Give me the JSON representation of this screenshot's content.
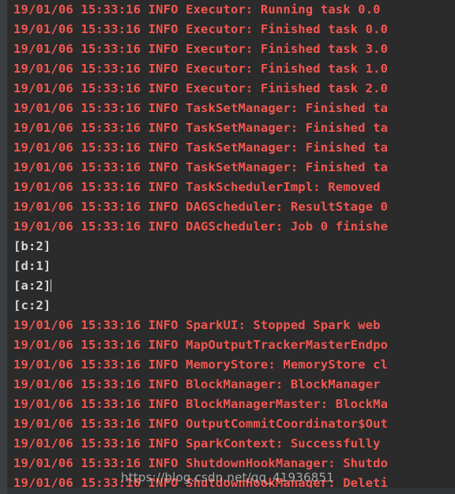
{
  "window": {
    "type": "ide-console-output",
    "background_color": "#2b2b2b",
    "gutter_color": "#3c3f41",
    "stderr_color": "#f4564f",
    "stdout_color": "#d4d8d8"
  },
  "console": {
    "lines": [
      {
        "stream": "stderr",
        "text": "19/01/06 15:33:16 INFO Executor: Running task 0.0"
      },
      {
        "stream": "stderr",
        "text": "19/01/06 15:33:16 INFO Executor: Finished task 0.0"
      },
      {
        "stream": "stderr",
        "text": "19/01/06 15:33:16 INFO Executor: Finished task 3.0"
      },
      {
        "stream": "stderr",
        "text": "19/01/06 15:33:16 INFO Executor: Finished task 1.0"
      },
      {
        "stream": "stderr",
        "text": "19/01/06 15:33:16 INFO Executor: Finished task 2.0"
      },
      {
        "stream": "stderr",
        "text": "19/01/06 15:33:16 INFO TaskSetManager: Finished ta"
      },
      {
        "stream": "stderr",
        "text": "19/01/06 15:33:16 INFO TaskSetManager: Finished ta"
      },
      {
        "stream": "stderr",
        "text": "19/01/06 15:33:16 INFO TaskSetManager: Finished ta"
      },
      {
        "stream": "stderr",
        "text": "19/01/06 15:33:16 INFO TaskSetManager: Finished ta"
      },
      {
        "stream": "stderr",
        "text": "19/01/06 15:33:16 INFO TaskSchedulerImpl: Removed "
      },
      {
        "stream": "stderr",
        "text": "19/01/06 15:33:16 INFO DAGScheduler: ResultStage 0"
      },
      {
        "stream": "stderr",
        "text": "19/01/06 15:33:16 INFO DAGScheduler: Job 0 finishe"
      },
      {
        "stream": "stdout",
        "text": "[b:2]"
      },
      {
        "stream": "stdout",
        "text": "[d:1]"
      },
      {
        "stream": "stdout",
        "text": "[a:2]",
        "caret": true
      },
      {
        "stream": "stdout",
        "text": "[c:2]"
      },
      {
        "stream": "stderr",
        "text": "19/01/06 15:33:16 INFO SparkUI: Stopped Spark web "
      },
      {
        "stream": "stderr",
        "text": "19/01/06 15:33:16 INFO MapOutputTrackerMasterEndpo"
      },
      {
        "stream": "stderr",
        "text": "19/01/06 15:33:16 INFO MemoryStore: MemoryStore cl"
      },
      {
        "stream": "stderr",
        "text": "19/01/06 15:33:16 INFO BlockManager: BlockManager "
      },
      {
        "stream": "stderr",
        "text": "19/01/06 15:33:16 INFO BlockManagerMaster: BlockMa"
      },
      {
        "stream": "stderr",
        "text": "19/01/06 15:33:16 INFO OutputCommitCoordinator$Out"
      },
      {
        "stream": "stderr",
        "text": "19/01/06 15:33:16 INFO SparkContext: Successfully "
      },
      {
        "stream": "stderr",
        "text": "19/01/06 15:33:16 INFO ShutdownHookManager: Shutdo"
      },
      {
        "stream": "stderr",
        "text": "19/01/06 15:33:16 INFO ShutdownHookManager: Deleti"
      }
    ]
  },
  "watermark": {
    "text": "https://blog.csdn.net/qq_41936851"
  }
}
